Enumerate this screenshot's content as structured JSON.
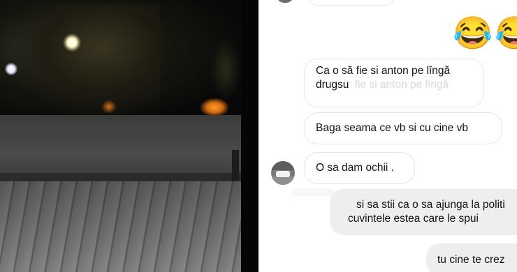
{
  "chat": {
    "messages": [
      {
        "line1": "Ca o să fie si anton pe lîngă",
        "line2": "drugsu",
        "ghost_text": "fie si anton pe lîngă"
      },
      {
        "text": "Baga seama ce vb si cu cine vb"
      },
      {
        "text": "O sa dam ochii ."
      },
      {
        "line1": "si sa stii ca o sa ajunga la politi",
        "line2": "cuvintele estea care le spui"
      },
      {
        "text": "tu cine te crez"
      }
    ],
    "emoji_1": "😂",
    "emoji_2": "😂"
  },
  "colors": {
    "incoming_bubble_border": "#e6e6e6",
    "outgoing_bubble_bg": "#eeeeee",
    "text": "#111111"
  }
}
